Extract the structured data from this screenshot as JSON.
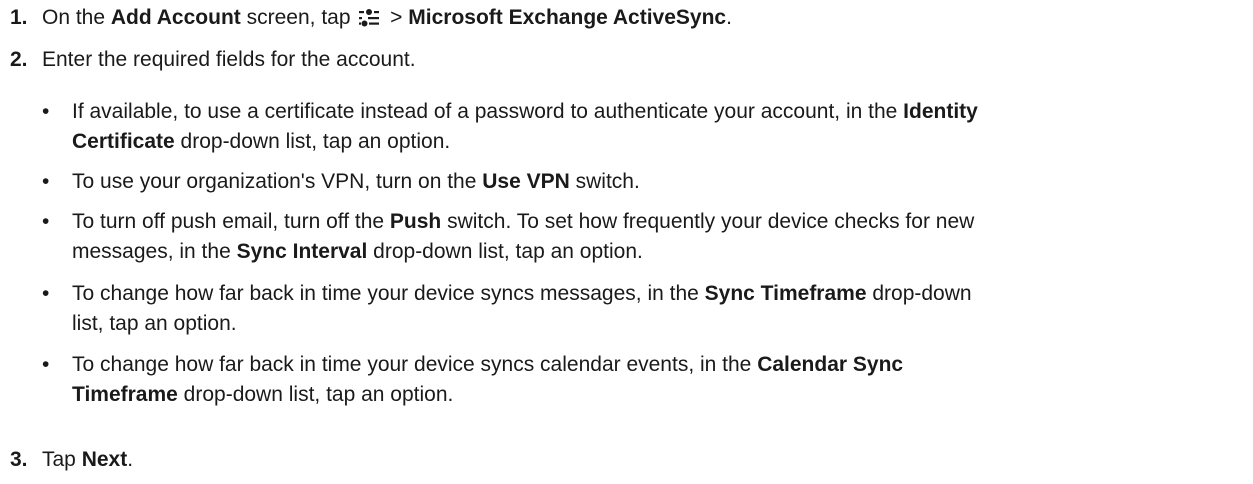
{
  "steps": [
    {
      "number": "1.",
      "prefix": "On the ",
      "screen": "Add Account",
      "mid": " screen, tap ",
      "icon": "menu-settings-icon",
      "gt": " > ",
      "target": "Microsoft Exchange ActiveSync",
      "end": "."
    },
    {
      "number": "2.",
      "text": "Enter the required fields for the account."
    },
    {
      "number": "3.",
      "prefix": "Tap ",
      "target": "Next",
      "end": "."
    }
  ],
  "bullets": [
    {
      "l1a": "If available, to use a certificate instead of a password to authenticate your account, in the ",
      "l1b": "Identity",
      "l2a": "Certificate",
      "l2b": " drop-down list, tap an option."
    },
    {
      "a": "To use your organization's VPN, turn on the ",
      "b": "Use VPN",
      "c": " switch."
    },
    {
      "l1a": "To turn off push email, turn off the ",
      "l1b": "Push",
      "l1c": " switch. To set how frequently your device checks for new",
      "l2a": "messages, in the ",
      "l2b": "Sync Interval",
      "l2c": " drop-down list, tap an option."
    },
    {
      "l1a": "To change how far back in time your device syncs messages, in the ",
      "l1b": "Sync Timeframe",
      "l1c": " drop-down",
      "l2a": "list, tap an option."
    },
    {
      "l1a": "To change how far back in time your device syncs calendar events, in the ",
      "l1b": "Calendar Sync",
      "l2a": "Timeframe",
      "l2b": " drop-down list, tap an option."
    }
  ],
  "bullet_char": "•"
}
